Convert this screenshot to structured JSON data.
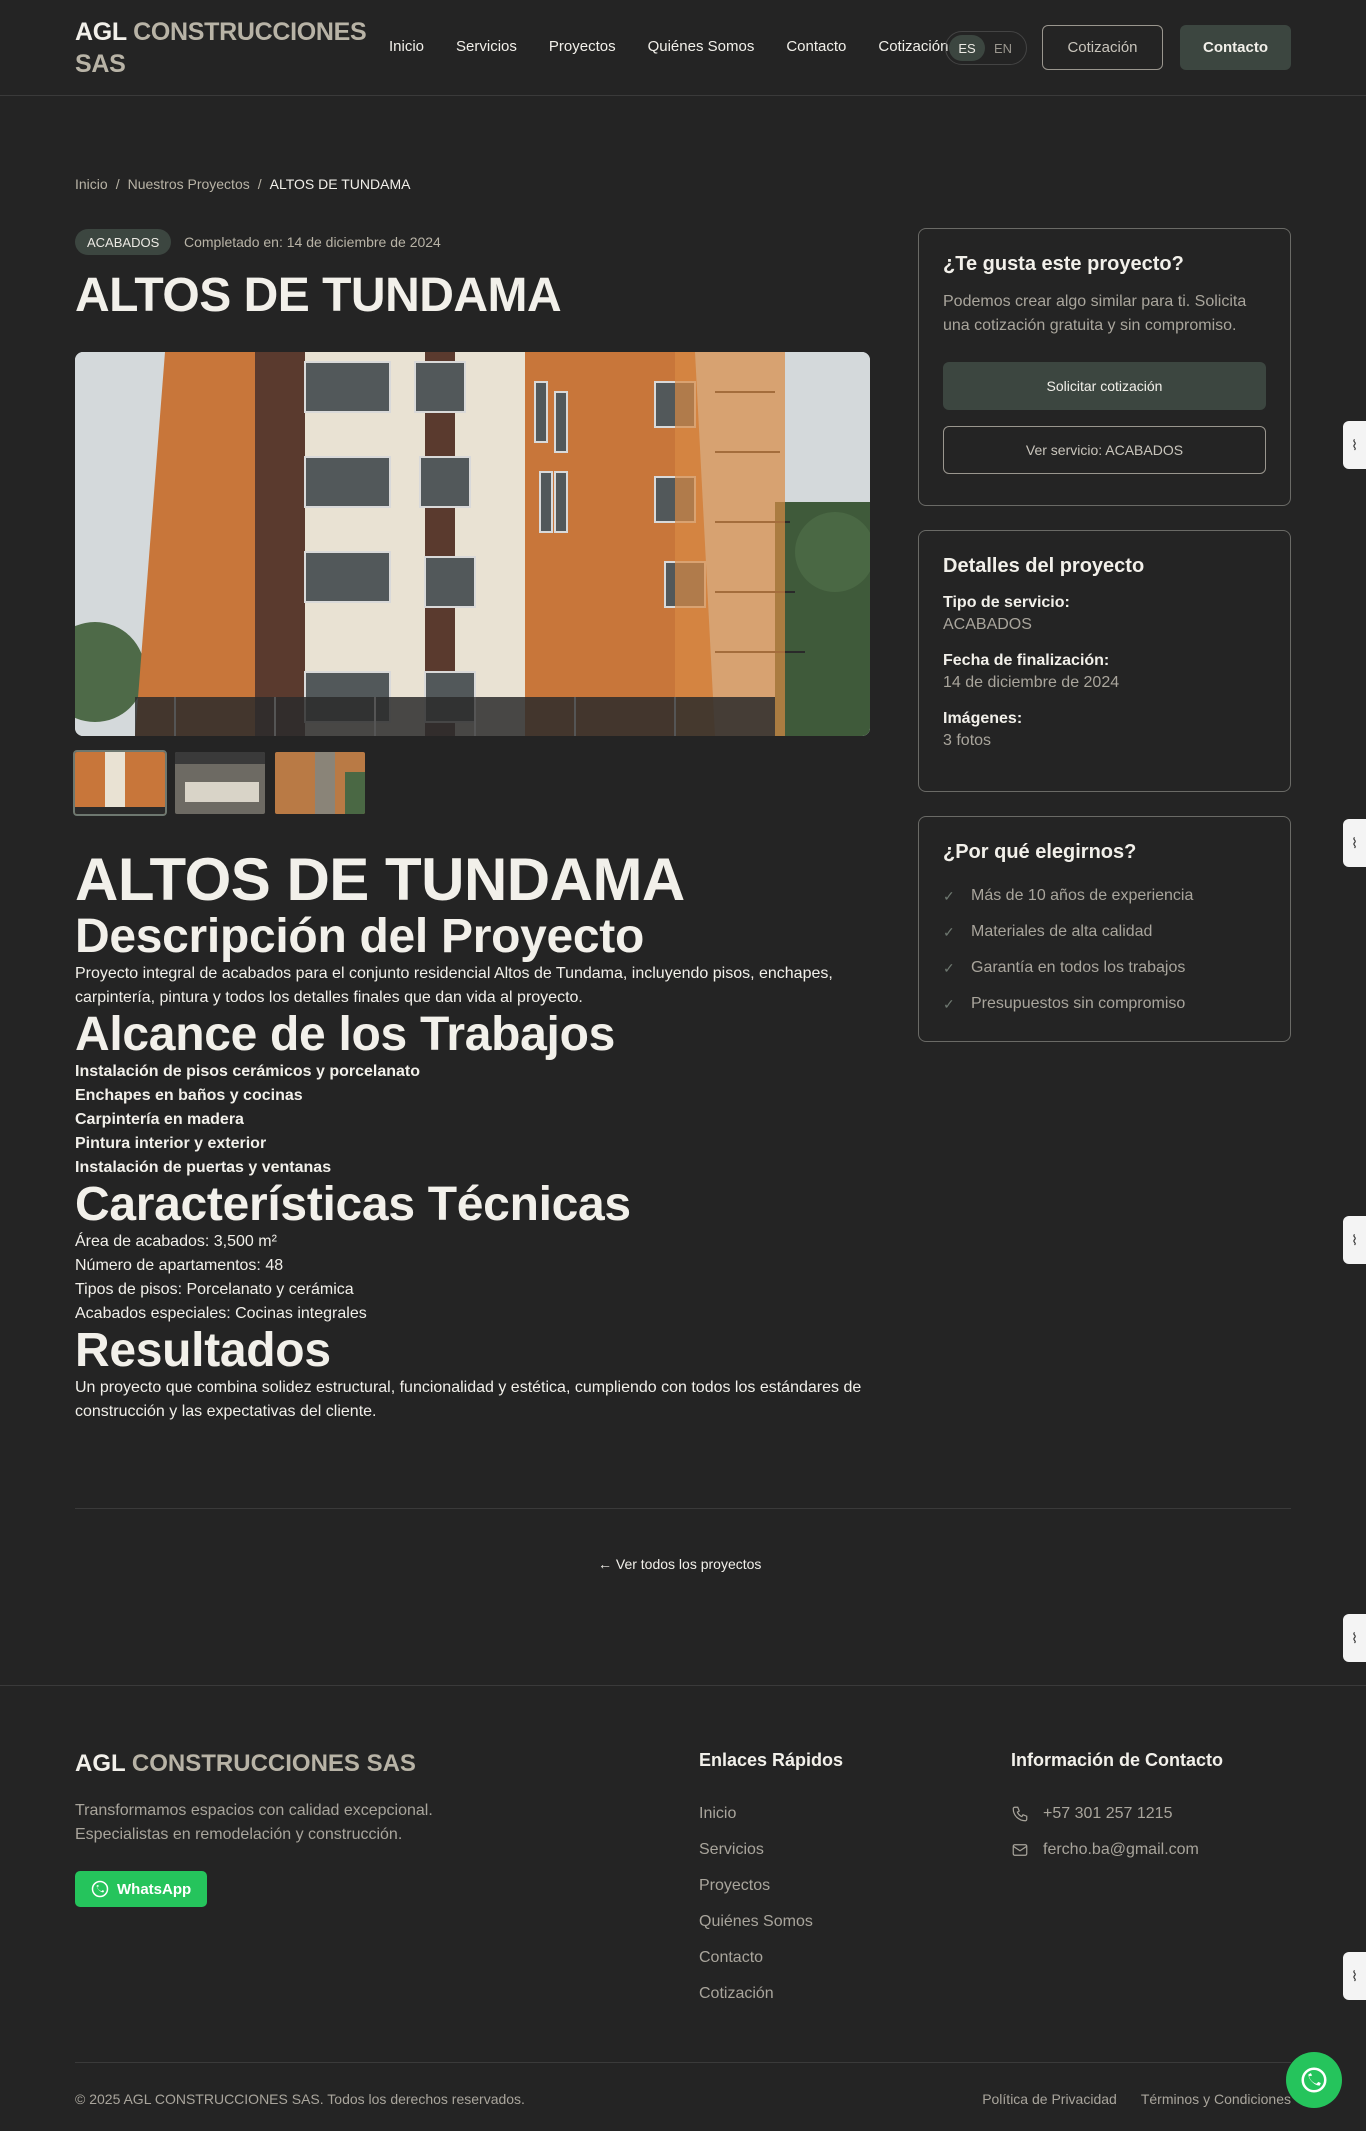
{
  "nav": {
    "brand_a": "AGL",
    "brand_b": "CONSTRUCCIONES SAS",
    "links": [
      "Inicio",
      "Servicios",
      "Proyectos",
      "Quiénes Somos",
      "Contacto",
      "Cotización"
    ],
    "lang": [
      "ES",
      "EN"
    ],
    "btn_quote": "Cotización",
    "btn_contact": "Contacto"
  },
  "breadcrumb": [
    "Inicio",
    "/",
    "Nuestros Proyectos",
    "/",
    "ALTOS DE TUNDAMA"
  ],
  "project": {
    "badge": "ACABADOS",
    "completed": "Completado en: 14 de diciembre de 2024",
    "title": "ALTOS DE TUNDAMA"
  },
  "content": {
    "h1": "ALTOS DE TUNDAMA",
    "desc_title": "Descripción del Proyecto",
    "desc_text": "Proyecto integral de acabados para el conjunto residencial Altos de Tundama, incluyendo pisos, enchapes, carpintería, pintura y todos los detalles finales que dan vida al proyecto.",
    "scope_title": "Alcance de los Trabajos",
    "scope": [
      "Instalación de pisos cerámicos y porcelanato",
      "Enchapes en baños y cocinas",
      "Carpintería en madera",
      "Pintura interior y exterior",
      "Instalación de puertas y ventanas"
    ],
    "tech_title": "Características Técnicas",
    "tech": [
      "Área de acabados: 3,500 m²",
      "Número de apartamentos: 48",
      "Tipos de pisos: Porcelanato y cerámica",
      "Acabados especiales: Cocinas integrales"
    ],
    "results_title": "Resultados",
    "results_text": "Un proyecto que combina solidez estructural, funcionalidad y estética, cumpliendo con todos los estándares de construcción y las expectativas del cliente."
  },
  "cta_card": {
    "title": "¿Te gusta este proyecto?",
    "text": "Podemos crear algo similar para ti. Solicita una cotización gratuita y sin compromiso.",
    "btn_primary": "Solicitar cotización",
    "btn_secondary": "Ver servicio: ACABADOS"
  },
  "details_card": {
    "title": "Detalles del proyecto",
    "service_label": "Tipo de servicio:",
    "service_value": "ACABADOS",
    "date_label": "Fecha de finalización:",
    "date_value": "14 de diciembre de 2024",
    "images_label": "Imágenes:",
    "images_value": "3 fotos"
  },
  "why_card": {
    "title": "¿Por qué elegirnos?",
    "items": [
      "Más de 10 años de experiencia",
      "Materiales de alta calidad",
      "Garantía en todos los trabajos",
      "Presupuestos sin compromiso"
    ]
  },
  "back_link": "← Ver todos los proyectos",
  "footer": {
    "brand_a": "AGL",
    "brand_b": "CONSTRUCCIONES SAS",
    "tagline": "Transformamos espacios con calidad excepcional. Especialistas en remodelación y construcción.",
    "whatsapp": "WhatsApp",
    "links_title": "Enlaces Rápidos",
    "links": [
      "Inicio",
      "Servicios",
      "Proyectos",
      "Quiénes Somos",
      "Contacto",
      "Cotización"
    ],
    "contact_title": "Información de Contacto",
    "phone": "+57 301 257 1215",
    "email": "fercho.ba@gmail.com",
    "copyright": "© 2025 AGL CONSTRUCCIONES SAS. Todos los derechos reservados.",
    "privacy": "Política de Privacidad",
    "terms": "Términos y Condiciones"
  },
  "colors": {
    "background": "#242424",
    "accent": "#3C4640",
    "whatsapp": "#25C45C"
  }
}
